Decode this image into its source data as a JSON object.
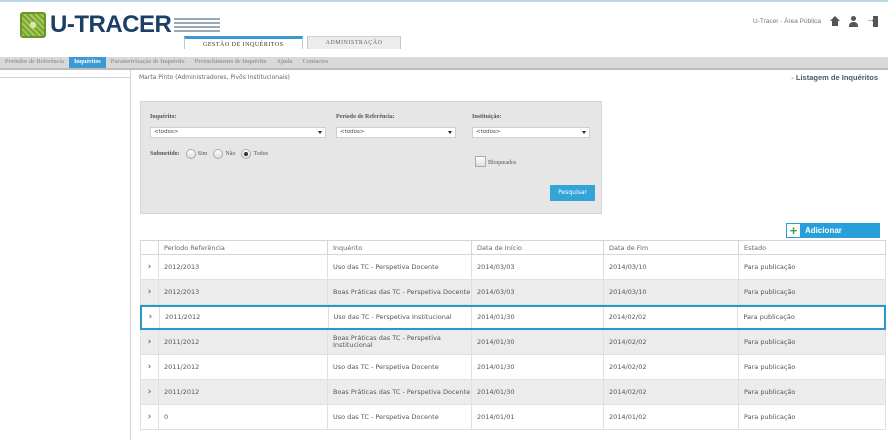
{
  "header": {
    "logo_text": "U-TRACER",
    "public_link": "U-Tracer - Área Pública",
    "main_tabs": [
      "GESTÃO DE INQUÉRITOS",
      "ADMINISTRAÇÃO"
    ]
  },
  "subnav": [
    "Períodos de Referência",
    "Inquéritos",
    "Parametrização de Inquérito",
    "Preenchimento de Inquérito",
    "Ajuda",
    "Contactos"
  ],
  "breadcrumb": "Marta Pinto (Administradores, Pivôs Institucionais)",
  "list_link": "Listagem de Inquéritos",
  "filter": {
    "inquerito_label": "Inquérito:",
    "inquerito_value": "<todos>",
    "periodo_label": "Período de Referência:",
    "periodo_value": "<todos>",
    "instituicao_label": "Instituição:",
    "instituicao_value": "<todos>",
    "submetido_label": "Submetido:",
    "radio_sim": "Sim",
    "radio_nao": "Não",
    "radio_todos": "Todos",
    "bloqueados_label": "Bloqueados",
    "search_label": "Pesquisar"
  },
  "add_label": "Adicionar",
  "table": {
    "headers": [
      "Período Referência",
      "Inquérito",
      "Data de Início",
      "Data de Fim",
      "Estado"
    ],
    "rows": [
      {
        "periodo": "2012/2013",
        "inquerito": "Uso das TC - Perspetiva Docente",
        "inicio": "2014/03/03",
        "fim": "2014/03/10",
        "estado": "Para publicação"
      },
      {
        "periodo": "2012/2013",
        "inquerito": "Boas Práticas das TC - Perspetiva Docente",
        "inicio": "2014/03/03",
        "fim": "2014/03/10",
        "estado": "Para publicação"
      },
      {
        "periodo": "2011/2012",
        "inquerito": "Uso das TC - Perspetiva Institucional",
        "inicio": "2014/01/30",
        "fim": "2014/02/02",
        "estado": "Para publicação"
      },
      {
        "periodo": "2011/2012",
        "inquerito": "Boas Práticas das TC - Perspetiva Institucional",
        "inicio": "2014/01/30",
        "fim": "2014/02/02",
        "estado": "Para publicação"
      },
      {
        "periodo": "2011/2012",
        "inquerito": "Uso das TC - Perspetiva Docente",
        "inicio": "2014/01/30",
        "fim": "2014/02/02",
        "estado": "Para publicação"
      },
      {
        "periodo": "2011/2012",
        "inquerito": "Boas Práticas das TC - Perspetiva Docente",
        "inicio": "2014/01/30",
        "fim": "2014/02/02",
        "estado": "Para publicação"
      },
      {
        "periodo": "0",
        "inquerito": "Uso das TC - Perspetiva Docente",
        "inicio": "2014/01/01",
        "fim": "2014/01/02",
        "estado": "Para publicação"
      }
    ]
  },
  "colors": {
    "accent": "#3c9ad3",
    "selected_border": "#2a97c8",
    "add_plus": "#3aa640"
  }
}
